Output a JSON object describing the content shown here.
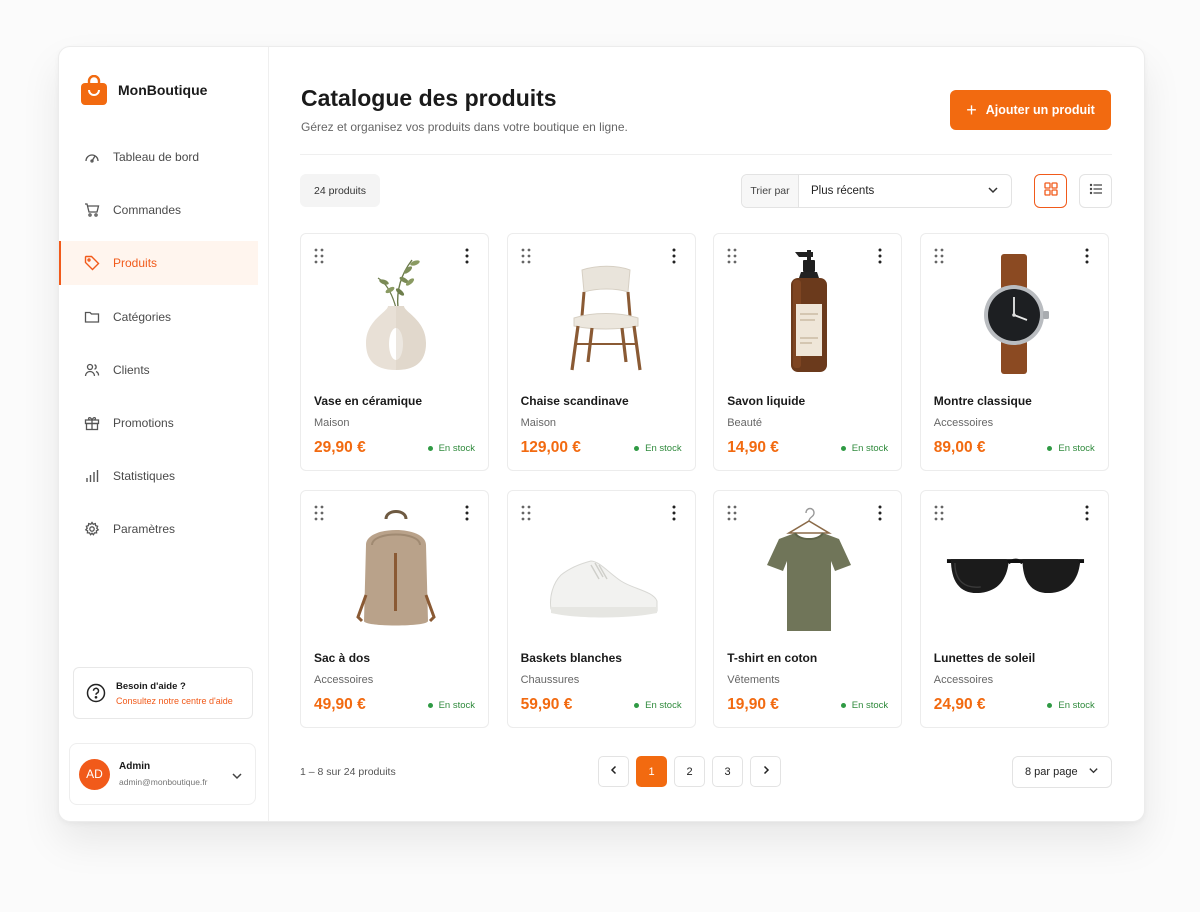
{
  "brand": {
    "name": "MonBoutique",
    "color": "#f26a10"
  },
  "nav": {
    "items": [
      {
        "label": "Tableau de bord",
        "icon": "dashboard-icon"
      },
      {
        "label": "Commandes",
        "icon": "cart-icon"
      },
      {
        "label": "Produits",
        "icon": "tag-icon",
        "active": true
      },
      {
        "label": "Catégories",
        "icon": "folder-icon"
      },
      {
        "label": "Clients",
        "icon": "users-icon"
      },
      {
        "label": "Promotions",
        "icon": "gift-icon"
      },
      {
        "label": "Statistiques",
        "icon": "bar-chart-icon"
      },
      {
        "label": "Paramètres",
        "icon": "gear-icon"
      }
    ]
  },
  "help": {
    "title": "Besoin d'aide ?",
    "link": "Consultez notre centre d'aide"
  },
  "user": {
    "initials": "AD",
    "name": "Admin",
    "email": "admin@monboutique.fr"
  },
  "header": {
    "title": "Catalogue des produits",
    "subtitle": "Gérez et organisez vos produits dans votre boutique en ligne.",
    "add_button": "Ajouter un produit"
  },
  "toolbar": {
    "count": "24 produits",
    "sort_label": "Trier par",
    "sort_value": "Plus récents",
    "view_mode": "grid"
  },
  "products": [
    {
      "name": "Vase en céramique",
      "category": "Maison",
      "price": "29,90 €",
      "stock": "En stock",
      "image": "vase"
    },
    {
      "name": "Chaise scandinave",
      "category": "Maison",
      "price": "129,00 €",
      "stock": "En stock",
      "image": "chair"
    },
    {
      "name": "Savon liquide",
      "category": "Beauté",
      "price": "14,90 €",
      "stock": "En stock",
      "image": "soap"
    },
    {
      "name": "Montre classique",
      "category": "Accessoires",
      "price": "89,00 €",
      "stock": "En stock",
      "image": "watch"
    },
    {
      "name": "Sac à dos",
      "category": "Accessoires",
      "price": "49,90 €",
      "stock": "En stock",
      "image": "backpack"
    },
    {
      "name": "Baskets blanches",
      "category": "Chaussures",
      "price": "59,90 €",
      "stock": "En stock",
      "image": "sneaker"
    },
    {
      "name": "T-shirt en coton",
      "category": "Vêtements",
      "price": "19,90 €",
      "stock": "En stock",
      "image": "tshirt"
    },
    {
      "name": "Lunettes de soleil",
      "category": "Accessoires",
      "price": "24,90 €",
      "stock": "En stock",
      "image": "sunglasses"
    }
  ],
  "pagination": {
    "info": "1 – 8 sur 24 produits",
    "pages": [
      "1",
      "2",
      "3"
    ],
    "current": "1",
    "per_page": "8 par page"
  }
}
